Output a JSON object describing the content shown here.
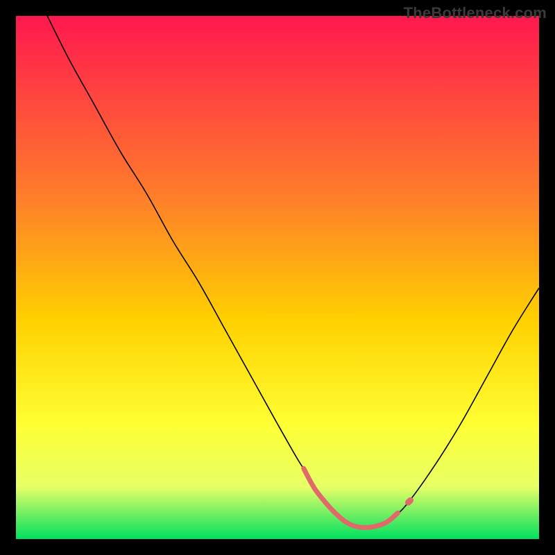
{
  "watermark": "TheBottleneck.com",
  "chart_data": {
    "type": "line",
    "title": "",
    "xlabel": "",
    "ylabel": "",
    "xlim": [
      0,
      100
    ],
    "ylim": [
      0,
      100
    ],
    "background_gradient": {
      "top": "#ff184f",
      "mid1": "#ff7f2a",
      "mid2": "#ffd000",
      "mid3": "#ffff33",
      "mid4": "#e8ff66",
      "bottom": "#00e060"
    },
    "series": [
      {
        "name": "bottleneck-curve",
        "color": "#000000",
        "width": 1.6,
        "x": [
          6,
          10,
          15,
          20,
          25,
          30,
          35,
          40,
          45,
          50,
          54,
          56,
          58,
          60,
          62,
          64,
          66,
          68,
          70,
          72,
          75,
          80,
          85,
          90,
          95,
          100
        ],
        "y": [
          100,
          92,
          83,
          74,
          66,
          57,
          49,
          40,
          31,
          22,
          15,
          12,
          8.5,
          6,
          4,
          2.8,
          2.2,
          2.2,
          2.8,
          4,
          7,
          14,
          22,
          31,
          40,
          48
        ]
      },
      {
        "name": "sweet-spot-highlight",
        "color": "#e06a6a",
        "width": 7,
        "linecap": "round",
        "x": [
          55,
          57,
          59,
          61,
          63,
          65,
          67,
          69,
          71,
          73
        ],
        "y": [
          13.5,
          9.8,
          7.2,
          5.0,
          3.3,
          2.4,
          2.2,
          2.5,
          3.3,
          5.0
        ]
      },
      {
        "name": "sweet-spot-dot",
        "color": "#e06a6a",
        "width": 9,
        "linecap": "round",
        "x": [
          75,
          75.4
        ],
        "y": [
          7,
          7.4
        ]
      }
    ]
  }
}
